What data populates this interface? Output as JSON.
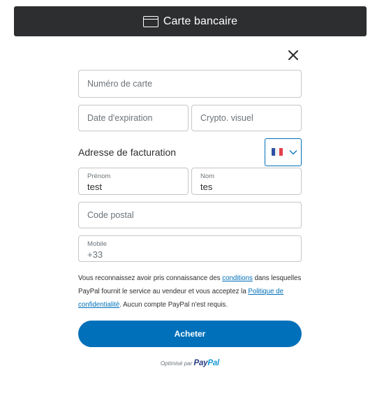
{
  "header": {
    "icon": "credit-card-icon",
    "title": "Carte bancaire",
    "background": "#2c2e2f"
  },
  "close": {
    "icon": "close-icon"
  },
  "form": {
    "card_number": {
      "placeholder": "Numéro de carte",
      "value": ""
    },
    "expiry": {
      "placeholder": "Date d'expiration",
      "value": ""
    },
    "cvv": {
      "placeholder": "Crypto. visuel",
      "value": ""
    },
    "billing_title": "Adresse de facturation",
    "country": {
      "selected": "FR",
      "flag": "france-flag-icon",
      "chevron": "chevron-down-icon"
    },
    "first_name": {
      "label": "Prénom",
      "value": "test"
    },
    "last_name": {
      "label": "Nom",
      "value": "tes"
    },
    "postal_code": {
      "placeholder": "Code postal",
      "value": ""
    },
    "mobile": {
      "label": "Mobile",
      "value": "+33"
    }
  },
  "legal": {
    "text1": "Vous reconnaissez avoir pris connaissance des ",
    "link1": "conditions",
    "text2": " dans lesquelles PayPal fournit le service au vendeur et vous acceptez la ",
    "link2": "Politique de confidentialité",
    "text3": ". Aucun compte PayPal n'est requis."
  },
  "buy_button": {
    "label": "Acheter",
    "color": "#0070ba"
  },
  "footer": {
    "powered_by": "Optimisé par",
    "brand_part1": "Pay",
    "brand_part2": "Pal"
  }
}
